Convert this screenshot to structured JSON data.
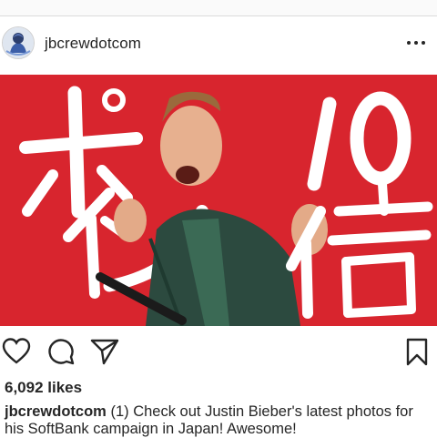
{
  "post": {
    "username": "jbcrewdotcom",
    "image": {
      "katakana_text": "ポイント倍",
      "number_text": "10",
      "background_color": "#d8252e"
    },
    "likes": "6,092 likes",
    "caption": {
      "username": "jbcrewdotcom",
      "text": "(1) Check out Justin Bieber's latest photos for his SoftBank campaign in Japan! Awesome!"
    },
    "icons": [
      "avatar",
      "more-options-icon",
      "heart-icon",
      "comment-icon",
      "share-icon",
      "bookmark-icon"
    ]
  }
}
